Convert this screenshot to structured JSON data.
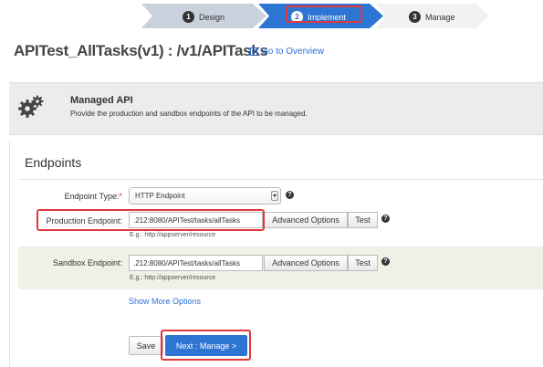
{
  "wizard": {
    "steps": [
      {
        "number": "1",
        "label": "Design"
      },
      {
        "number": "2",
        "label": "Implement"
      },
      {
        "number": "3",
        "label": "Manage"
      }
    ],
    "active_step": "2"
  },
  "header": {
    "api_title": "APITest_AllTasks(v1) : /v1/APITasks",
    "overview_link": "Go to Overview"
  },
  "managed_api": {
    "title": "Managed API",
    "description": "Provide the production and sandbox endpoints of the API to be managed."
  },
  "endpoints": {
    "heading": "Endpoints",
    "type_label": "Endpoint Type:",
    "required_mark": "*",
    "type_value": "HTTP Endpoint",
    "production": {
      "label": "Production Endpoint:",
      "value": ".212:8080/APITest/tasks/allTasks",
      "hint": "E.g.: http://appserver/resource",
      "advanced_label": "Advanced Options",
      "test_label": "Test"
    },
    "sandbox": {
      "label": "Sandbox Endpoint:",
      "value": ".212:8080/APITest/tasks/allTasks",
      "hint": "E.g.: http://appserver/resource",
      "advanced_label": "Advanced Options",
      "test_label": "Test"
    },
    "help_glyph": "?",
    "show_more": "Show More Options"
  },
  "actions": {
    "save": "Save",
    "next": "Next : Manage >"
  },
  "colors": {
    "accent": "#2d75d3",
    "highlight": "#e0383d",
    "panel": "#ececec"
  },
  "icons": [
    "gears-icon",
    "document-icon",
    "help-icon",
    "dropdown-arrow-icon"
  ]
}
